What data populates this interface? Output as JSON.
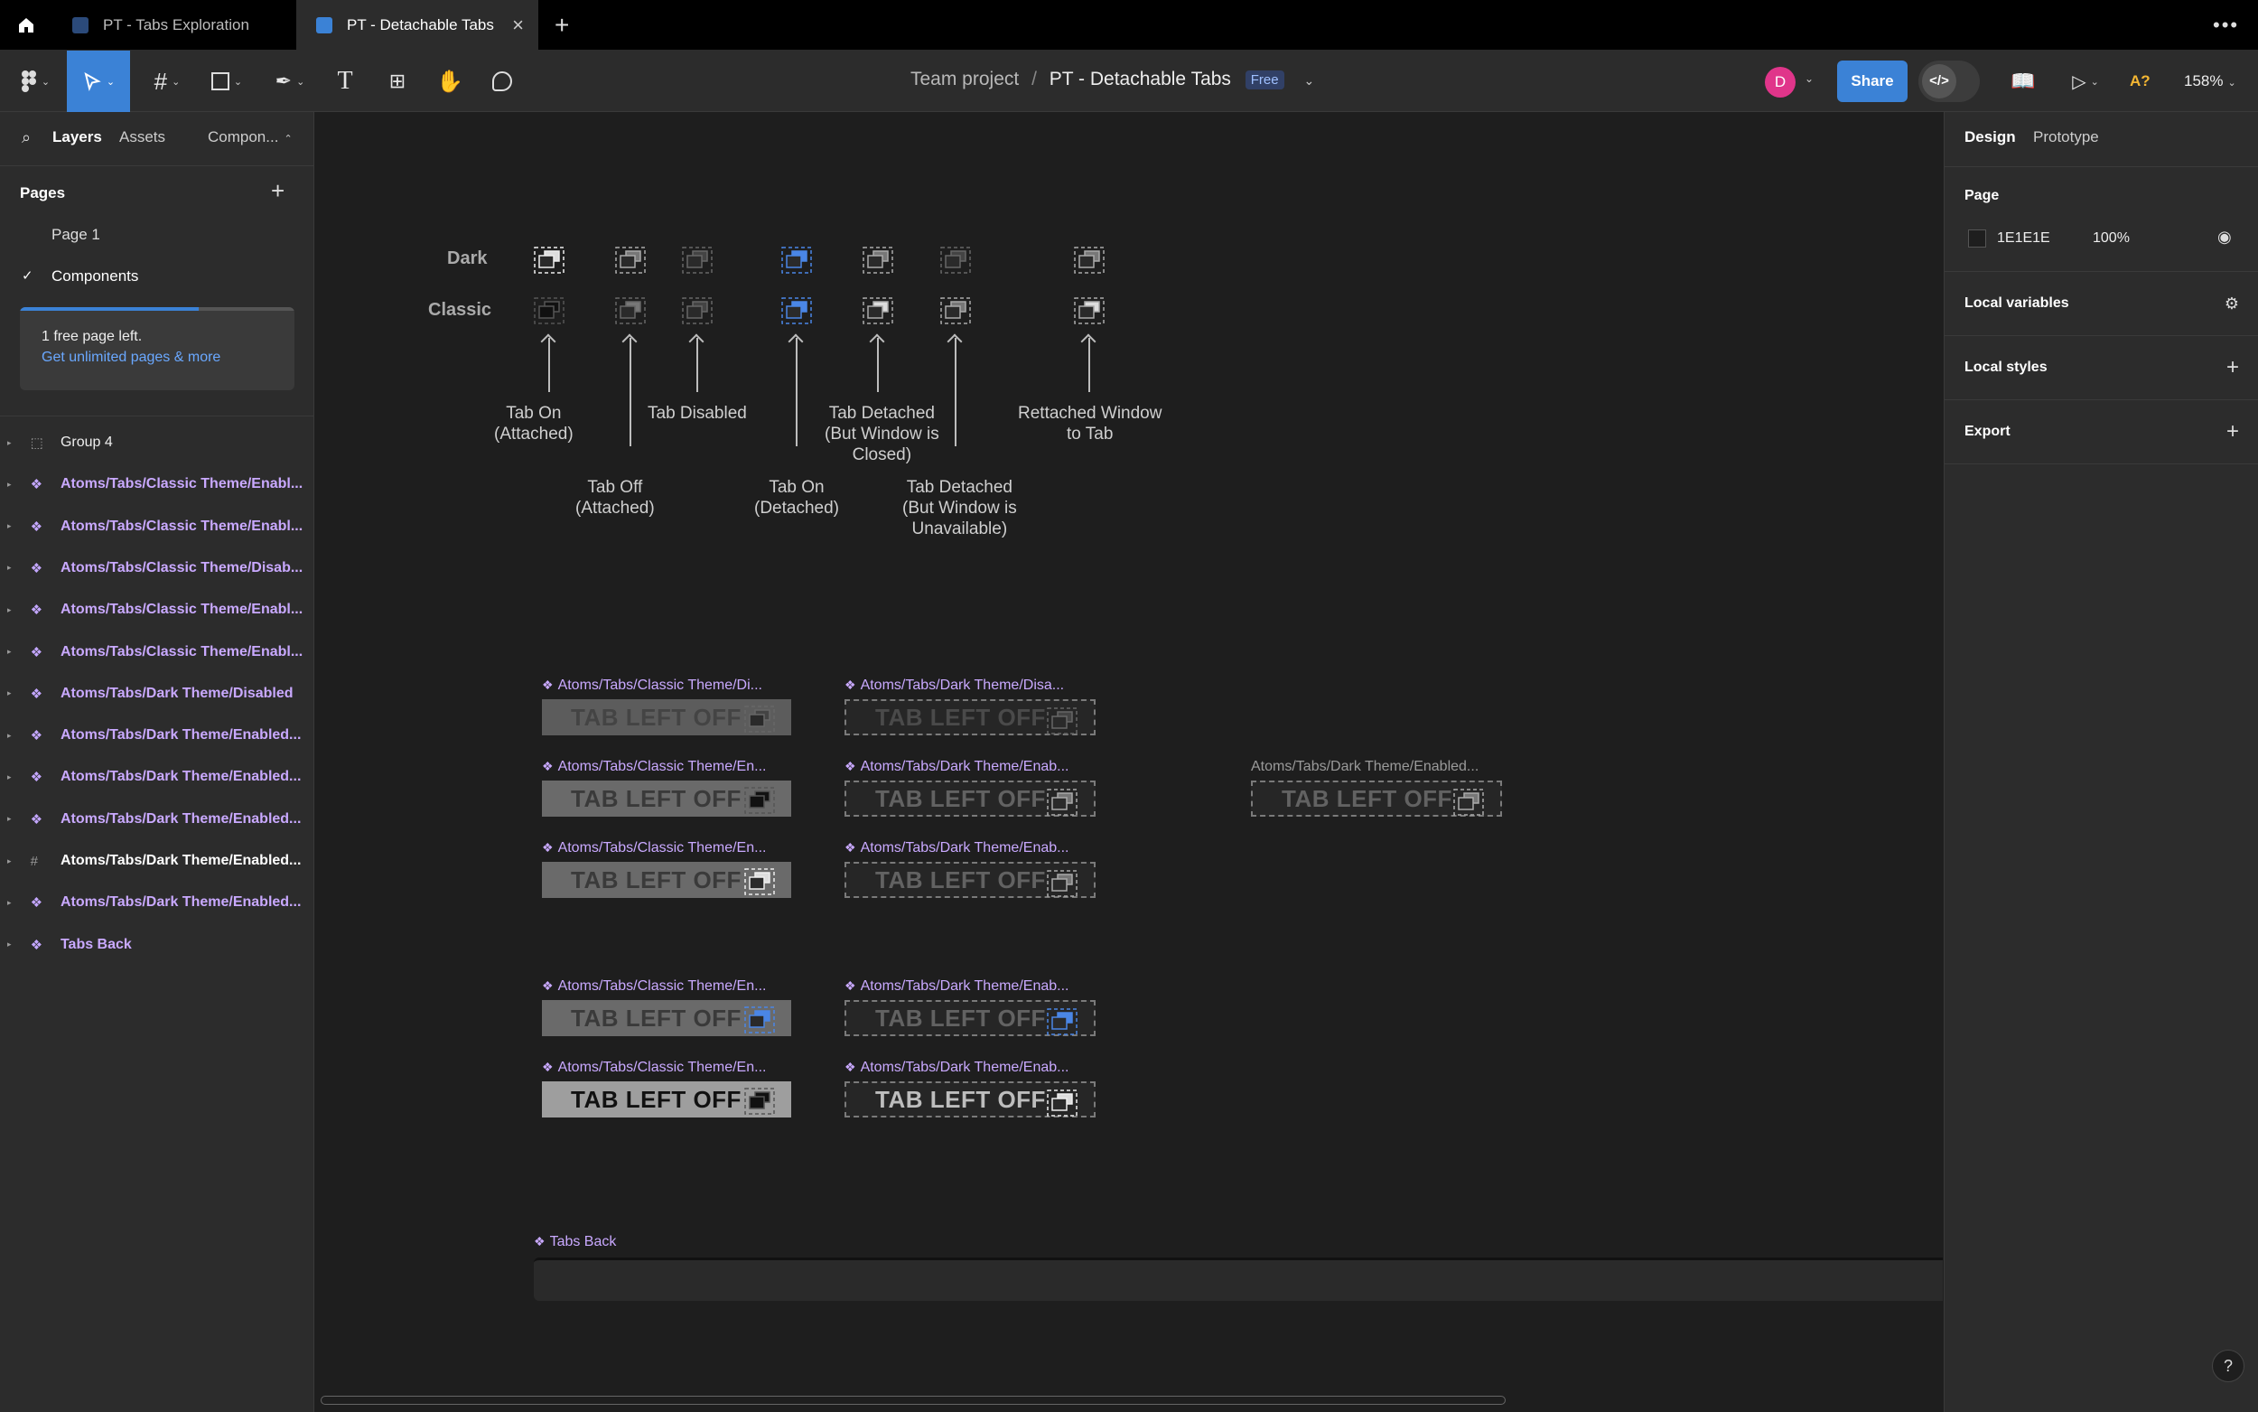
{
  "titlebar": {
    "tabs": [
      {
        "label": "PT - Tabs Exploration"
      },
      {
        "label": "PT - Detachable Tabs"
      }
    ]
  },
  "toolbar": {
    "breadcrumb_team": "Team project",
    "breadcrumb_sep": "/",
    "file_name": "PT - Detachable Tabs",
    "plan_badge": "Free",
    "avatar_initial": "D",
    "share_label": "Share",
    "ai_label": "A?",
    "zoom": "158%"
  },
  "left": {
    "tabs": {
      "layers": "Layers",
      "assets": "Assets",
      "components": "Compon..."
    },
    "pages_title": "Pages",
    "pages": [
      {
        "label": "Page 1"
      },
      {
        "label": "Components"
      }
    ],
    "upsell": {
      "text": "1 free page left.",
      "link": "Get unlimited pages & more"
    },
    "layers": [
      {
        "label": "Group 4"
      },
      {
        "label": "Atoms/Tabs/Classic Theme/Enabl..."
      },
      {
        "label": "Atoms/Tabs/Classic Theme/Enabl..."
      },
      {
        "label": "Atoms/Tabs/Classic Theme/Disab..."
      },
      {
        "label": "Atoms/Tabs/Classic Theme/Enabl..."
      },
      {
        "label": "Atoms/Tabs/Classic Theme/Enabl..."
      },
      {
        "label": "Atoms/Tabs/Dark Theme/Disabled"
      },
      {
        "label": "Atoms/Tabs/Dark Theme/Enabled..."
      },
      {
        "label": "Atoms/Tabs/Dark Theme/Enabled..."
      },
      {
        "label": "Atoms/Tabs/Dark Theme/Enabled..."
      },
      {
        "label": "Atoms/Tabs/Dark Theme/Enabled..."
      },
      {
        "label": "Atoms/Tabs/Dark Theme/Enabled..."
      },
      {
        "label": "Tabs Back"
      }
    ]
  },
  "right": {
    "tabs": {
      "design": "Design",
      "prototype": "Prototype"
    },
    "page_title": "Page",
    "page_color": "1E1E1E",
    "page_opacity": "100%",
    "local_variables": "Local variables",
    "local_styles": "Local styles",
    "export": "Export"
  },
  "canvas": {
    "row_dark": "Dark",
    "row_classic": "Classic",
    "labels": {
      "tab_on_att": "Tab On\n(Attached)",
      "tab_off_att": "Tab Off\n(Attached)",
      "tab_disabled": "Tab Disabled",
      "tab_on_det": "Tab On\n(Detached)",
      "tab_det_closed": "Tab Detached\n(But Window is\nClosed)",
      "tab_det_unavail": "Tab Detached\n(But Window is\nUnavailable)",
      "retached": "Rettached Window\nto Tab"
    },
    "tab_text": "TAB LEFT OFF",
    "component_names": {
      "c1": "Atoms/Tabs/Classic Theme/Di...",
      "d1": "Atoms/Tabs/Dark Theme/Disa...",
      "c2": "Atoms/Tabs/Classic Theme/En...",
      "d2": "Atoms/Tabs/Dark Theme/Enab...",
      "x1": "Atoms/Tabs/Dark Theme/Enabled...",
      "c3": "Atoms/Tabs/Classic Theme/En...",
      "d3": "Atoms/Tabs/Dark Theme/Enab...",
      "c4": "Atoms/Tabs/Classic Theme/En...",
      "d4": "Atoms/Tabs/Dark Theme/Enab...",
      "c5": "Atoms/Tabs/Classic Theme/En...",
      "d5": "Atoms/Tabs/Dark Theme/Enab...",
      "tabs_back": "Tabs Back"
    }
  },
  "colors": {
    "accent": "#3b82d6",
    "component": "#c9a9ff",
    "avatar": "#e0358a"
  },
  "help": "?"
}
